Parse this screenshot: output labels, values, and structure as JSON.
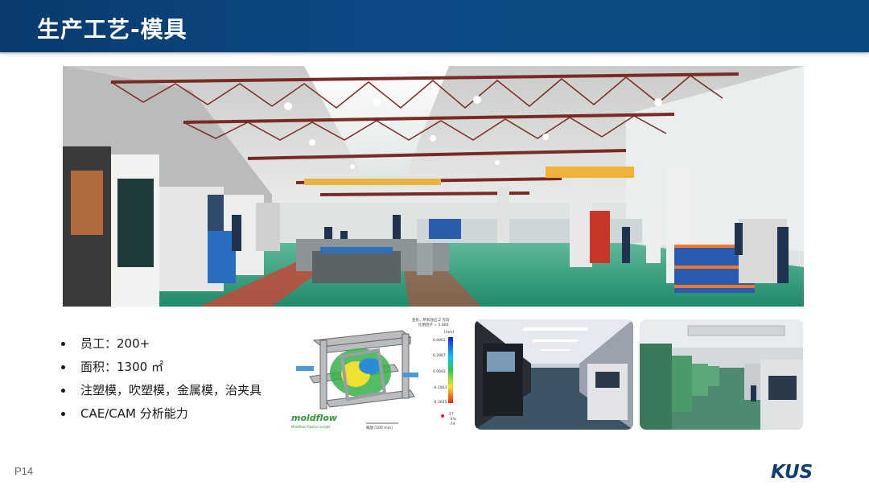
{
  "header": {
    "title": "生产工艺-模具"
  },
  "bullets": [
    "员工：200+",
    "面积：1300 ㎡",
    "注塑模，吹塑模，金属模，治夹具",
    "CAE/CAM 分析能力"
  ],
  "moldflow": {
    "logo": "moldflow",
    "logo_sub": "Moldflow Plastics Insight",
    "title_line1": "变形，所有效应:Z 方向",
    "title_line2": "比例因子 = 1.000",
    "unit": "[mm]",
    "scale_values": [
      "0.4002",
      "0.2887",
      "0.0692",
      "-0.1903",
      "-0.3655"
    ],
    "scale_label": "缩放 [100 mm]",
    "axis_labels": [
      "27",
      "-3%",
      "-74"
    ]
  },
  "footer": {
    "page": "P14",
    "logo": "KUS"
  },
  "colors": {
    "header": "#0d4a86",
    "logo": "#0d3e78",
    "floor": "#2f9a7a"
  }
}
